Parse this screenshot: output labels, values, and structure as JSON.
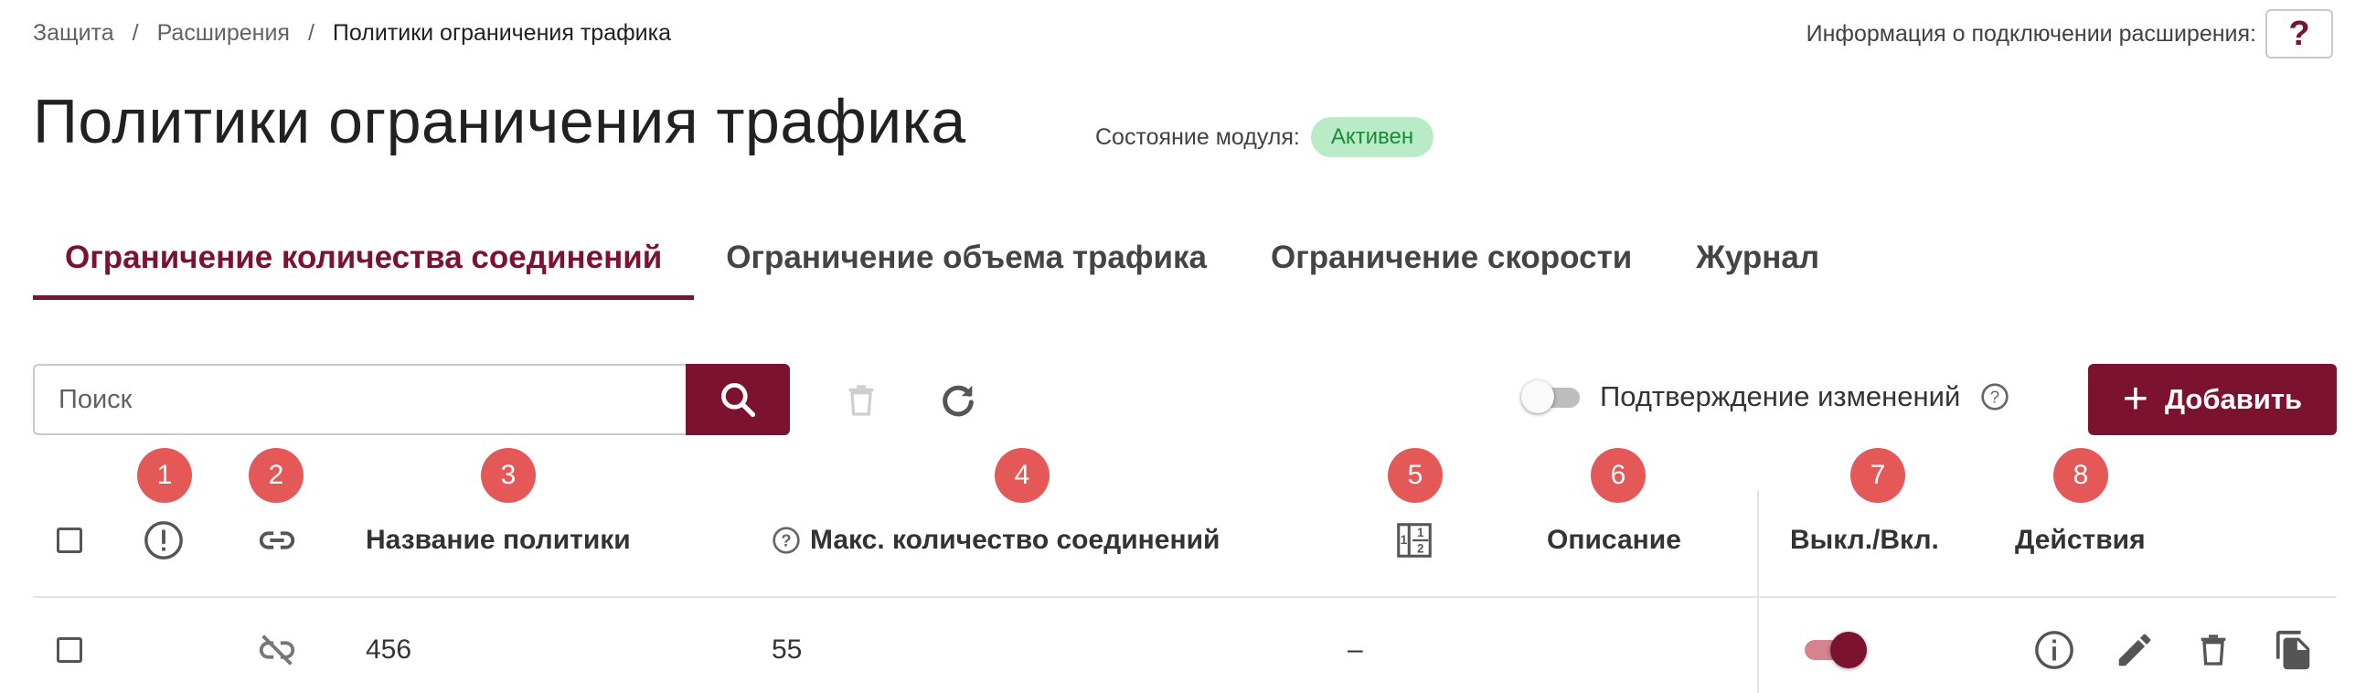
{
  "breadcrumb": {
    "items": [
      "Защита",
      "Расширения",
      "Политики ограничения трафика"
    ],
    "separator": "/"
  },
  "connection_info": {
    "label": "Информация о подключении расширения:",
    "help_symbol": "?"
  },
  "page": {
    "title": "Политики ограничения трафика",
    "module_state_label": "Состояние модуля:",
    "module_state_value": "Активен"
  },
  "tabs": [
    {
      "label": "Ограничение количества соединений",
      "active": true
    },
    {
      "label": "Ограничение объема трафика",
      "active": false
    },
    {
      "label": "Ограничение скорости",
      "active": false
    },
    {
      "label": "Журнал",
      "active": false
    }
  ],
  "toolbar": {
    "search_placeholder": "Поиск",
    "confirm_label": "Подтверждение изменений",
    "confirm_enabled": false,
    "add_label": "Добавить",
    "add_symbol": "+"
  },
  "markers": [
    "1",
    "2",
    "3",
    "4",
    "5",
    "6",
    "7",
    "8"
  ],
  "table": {
    "columns": {
      "warning": "warning-icon",
      "link": "link-icon",
      "name": "Название политики",
      "max_connections": "Макс. количество соединений",
      "order": "order-icon",
      "description": "Описание",
      "enabled": "Выкл./Вкл.",
      "actions": "Действия"
    },
    "rows": [
      {
        "name": "456",
        "max_connections": "55",
        "order": "–",
        "description": "",
        "linked": false,
        "enabled": true
      }
    ]
  },
  "colors": {
    "accent": "#7b1230",
    "marker": "#e45858",
    "status_bg": "#b9ebc7",
    "status_text": "#1b8a3a"
  },
  "icons": [
    "search-icon",
    "trash-icon",
    "refresh-icon",
    "question-circle-icon",
    "plus-icon",
    "warning-icon",
    "link-icon",
    "unlink-icon",
    "order-icon",
    "info-icon",
    "edit-icon",
    "delete-icon",
    "copy-icon"
  ]
}
